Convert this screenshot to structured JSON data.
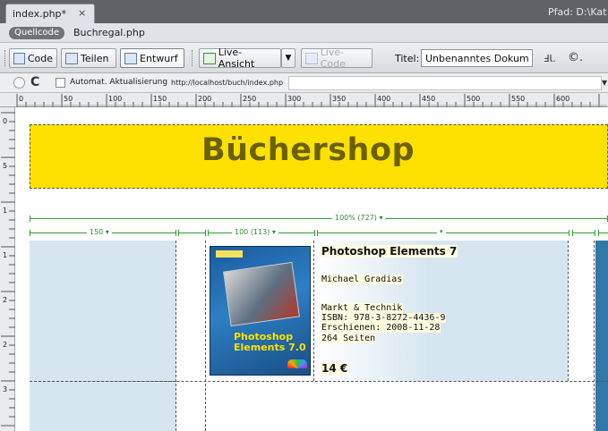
{
  "tabs": {
    "active_label": "index.php*",
    "close_glyph": "×",
    "path_label": "Pfad: D:\\Kat"
  },
  "related": {
    "source_label": "Quellcode",
    "file_label": "Buchregal.php"
  },
  "toolbar": {
    "code_label": "Code",
    "split_label": "Teilen",
    "design_label": "Entwurf",
    "live_view_label": "Live-Ansicht",
    "live_code_label": "Live-Code",
    "title_label": "Titel:",
    "title_value": "Unbenanntes Dokument",
    "ext_icon_1": "ℲƖ.",
    "ext_icon_2": "©."
  },
  "navbar": {
    "auto_refresh_label": "Automat. Aktualisierung",
    "url": "http://localhost/buch/index.php",
    "dropdown_glyph": "▼"
  },
  "ruler": {
    "h_labels": [
      "0",
      "50",
      "100",
      "150",
      "200",
      "250",
      "300",
      "350",
      "400",
      "450",
      "500",
      "550",
      "600"
    ],
    "v_labels": [
      "0",
      "5",
      "1",
      "1",
      "2",
      "2",
      "3"
    ]
  },
  "page": {
    "header_title": "Büchershop",
    "header_color": "#ffe100",
    "width_guide_total": "100% (727) ▾",
    "width_guide_col1": "150 ▾",
    "width_guide_col2": "100 (113) ▾"
  },
  "book": {
    "cover_line1": "Photoshop",
    "cover_line2": "Elements 7.0",
    "title": "Photoshop Elements 7",
    "author": "Michael Gradias",
    "publisher": "Markt & Technik",
    "isbn": "ISBN: 978-3-8272-4436-9",
    "published": "Erschienen: 2008-11-28",
    "pages": "264 Seiten",
    "price": "14 €"
  },
  "colors": {
    "accent_blue": "#2f78a8",
    "sidebar_bg": "#d6e6f0",
    "guide_green": "#2e9e2e"
  }
}
